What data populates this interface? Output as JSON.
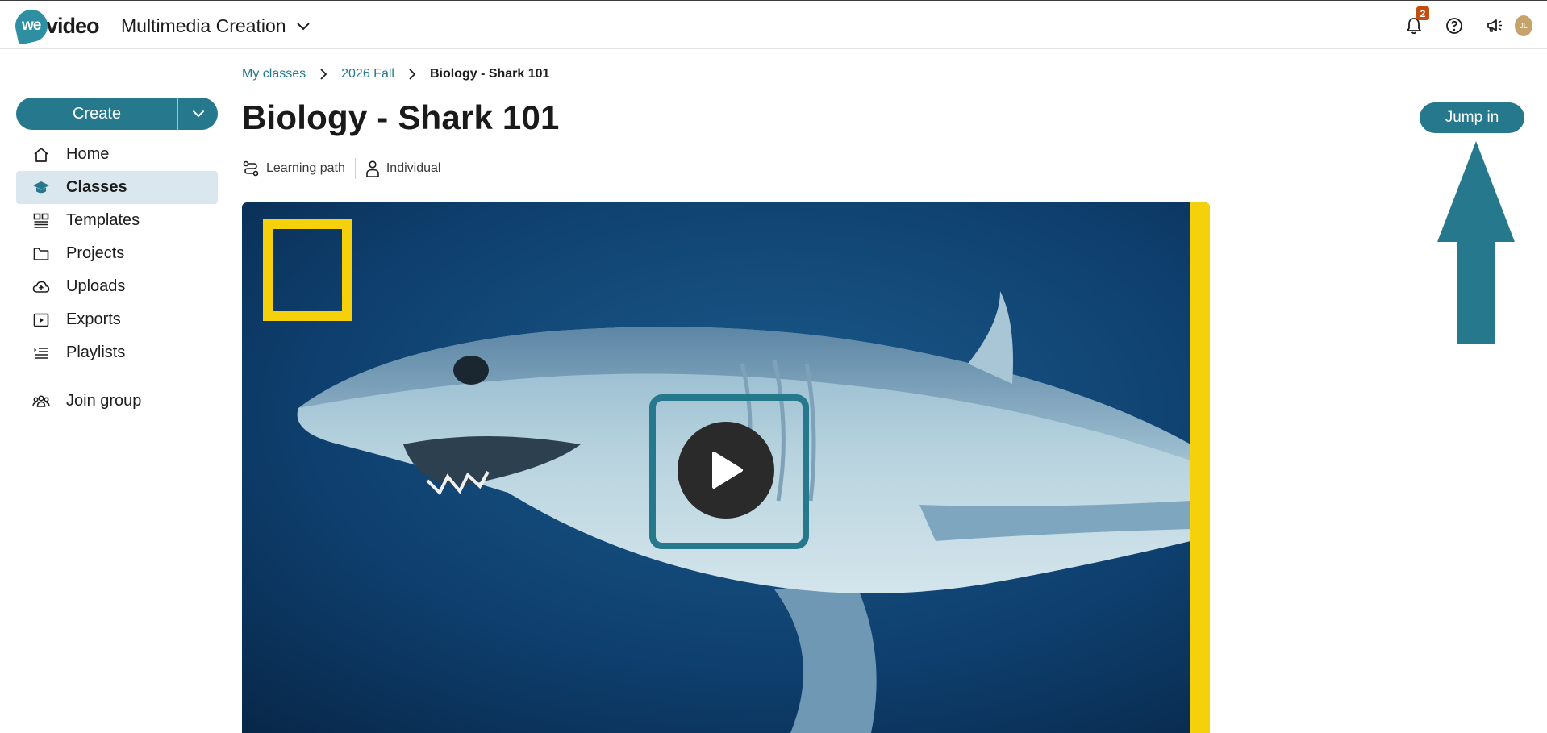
{
  "header": {
    "logo_text": "wevideo",
    "logo_badge": "we",
    "logo_wordmark": "video",
    "workspace_name": "Multimedia Creation",
    "notification_count": "2",
    "avatar_initials": "JL",
    "accent_color": "#26798c"
  },
  "sidebar": {
    "create_label": "Create",
    "items": [
      {
        "label": "Home",
        "icon": "home-icon"
      },
      {
        "label": "Classes",
        "icon": "graduation-cap-icon",
        "active": true
      },
      {
        "label": "Templates",
        "icon": "templates-icon"
      },
      {
        "label": "Projects",
        "icon": "folder-icon"
      },
      {
        "label": "Uploads",
        "icon": "cloud-upload-icon"
      },
      {
        "label": "Exports",
        "icon": "play-square-icon"
      },
      {
        "label": "Playlists",
        "icon": "playlist-icon"
      }
    ],
    "join_group_label": "Join group"
  },
  "breadcrumb": {
    "items": [
      "My classes",
      "2026 Fall"
    ],
    "current": "Biology - Shark 101"
  },
  "page": {
    "title": "Biology - Shark 101",
    "meta": {
      "type_label": "Learning path",
      "mode_label": "Individual"
    },
    "jump_in_label": "Jump in"
  },
  "video": {
    "thumbnail": "shark-thumbnail",
    "play_icon": "play-icon"
  }
}
